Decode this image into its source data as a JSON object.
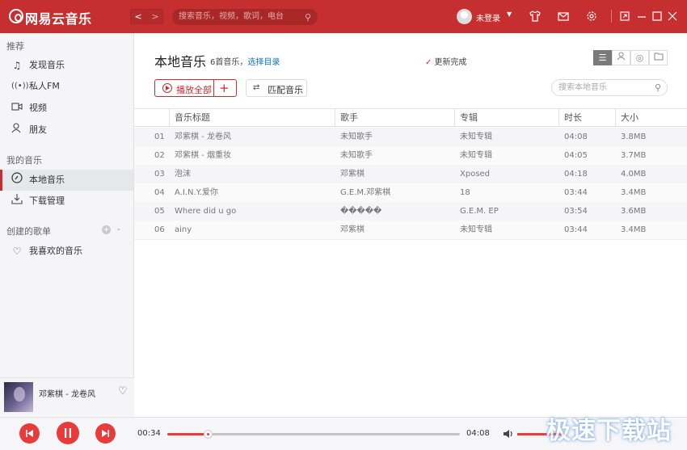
{
  "app": {
    "name": "网易云音乐"
  },
  "topbar": {
    "back": "<",
    "forward": ">",
    "search_placeholder": "搜索音乐，视频，歌词，电台",
    "user": "未登录",
    "icons": [
      "skin-icon",
      "mail-icon",
      "settings-icon",
      "mini-mode-icon",
      "minimize-icon",
      "maximize-icon",
      "close-icon"
    ]
  },
  "sidebar": {
    "section1": "推荐",
    "rec": [
      {
        "icon": "music-note-icon",
        "label": "发现音乐"
      },
      {
        "icon": "radio-icon",
        "label": "私人FM"
      },
      {
        "icon": "video-icon",
        "label": "视频"
      },
      {
        "icon": "friends-icon",
        "label": "朋友"
      }
    ],
    "section2": "我的音乐",
    "mine": [
      {
        "icon": "disc-icon",
        "label": "本地音乐",
        "active": true
      },
      {
        "icon": "download-icon",
        "label": "下载管理"
      }
    ],
    "section3": "创建的歌单",
    "playlists": [
      {
        "icon": "heart-icon",
        "label": "我喜欢的音乐"
      }
    ]
  },
  "nowplaying": {
    "title": "邓紫棋 - 龙卷风"
  },
  "main": {
    "title": "本地音乐",
    "count_text": "6首音乐，",
    "choose_dir": "选择目录",
    "update_status": "更新完成",
    "play_all": "播放全部",
    "match": "匹配音乐",
    "search_placeholder": "搜索本地音乐"
  },
  "table": {
    "headers": [
      "音乐标题",
      "歌手",
      "专辑",
      "时长",
      "大小"
    ],
    "rows": [
      {
        "idx": "01",
        "title": "邓紫棋 - 龙卷风",
        "artist": "未知歌手",
        "album": "未知专辑",
        "duration": "04:08",
        "size": "3.8MB"
      },
      {
        "idx": "02",
        "title": "邓紫棋 - 烟重妆",
        "artist": "未知歌手",
        "album": "未知专辑",
        "duration": "04:05",
        "size": "3.7MB"
      },
      {
        "idx": "03",
        "title": "泡沫",
        "artist": "邓紫棋",
        "album": "Xposed",
        "duration": "04:18",
        "size": "4.0MB"
      },
      {
        "idx": "04",
        "title": "A.I.N.Y.爱你",
        "artist": "G.E.M.邓紫棋",
        "album": "18",
        "duration": "03:44",
        "size": "3.4MB"
      },
      {
        "idx": "05",
        "title": "Where did u go",
        "artist": "�����",
        "album": "G.E.M. EP",
        "duration": "03:54",
        "size": "3.6MB"
      },
      {
        "idx": "06",
        "title": "ainy",
        "artist": "邓紫棋",
        "album": "未知专辑",
        "duration": "03:44",
        "size": "3.4MB"
      }
    ]
  },
  "player": {
    "elapsed": "00:34",
    "total": "04:08",
    "progress": 0.137
  },
  "watermark": "极速下载站",
  "colors": {
    "accent": "#c62f2f",
    "player_red": "#e83c3c"
  }
}
